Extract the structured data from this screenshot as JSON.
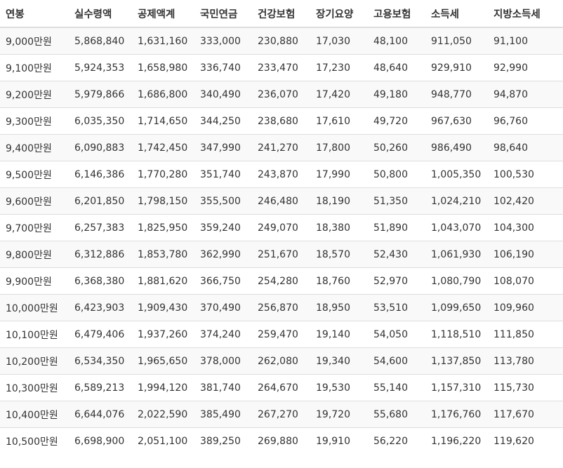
{
  "table": {
    "headers": [
      "연봉",
      "실수령액",
      "공제액계",
      "국민연금",
      "건강보험",
      "장기요양",
      "고용보험",
      "소득세",
      "지방소득세"
    ],
    "rows": [
      [
        "9,000만원",
        "5,868,840",
        "1,631,160",
        "333,000",
        "230,880",
        "17,030",
        "48,100",
        "911,050",
        "91,100"
      ],
      [
        "9,100만원",
        "5,924,353",
        "1,658,980",
        "336,740",
        "233,470",
        "17,230",
        "48,640",
        "929,910",
        "92,990"
      ],
      [
        "9,200만원",
        "5,979,866",
        "1,686,800",
        "340,490",
        "236,070",
        "17,420",
        "49,180",
        "948,770",
        "94,870"
      ],
      [
        "9,300만원",
        "6,035,350",
        "1,714,650",
        "344,250",
        "238,680",
        "17,610",
        "49,720",
        "967,630",
        "96,760"
      ],
      [
        "9,400만원",
        "6,090,883",
        "1,742,450",
        "347,990",
        "241,270",
        "17,800",
        "50,260",
        "986,490",
        "98,640"
      ],
      [
        "9,500만원",
        "6,146,386",
        "1,770,280",
        "351,740",
        "243,870",
        "17,990",
        "50,800",
        "1,005,350",
        "100,530"
      ],
      [
        "9,600만원",
        "6,201,850",
        "1,798,150",
        "355,500",
        "246,480",
        "18,190",
        "51,350",
        "1,024,210",
        "102,420"
      ],
      [
        "9,700만원",
        "6,257,383",
        "1,825,950",
        "359,240",
        "249,070",
        "18,380",
        "51,890",
        "1,043,070",
        "104,300"
      ],
      [
        "9,800만원",
        "6,312,886",
        "1,853,780",
        "362,990",
        "251,670",
        "18,570",
        "52,430",
        "1,061,930",
        "106,190"
      ],
      [
        "9,900만원",
        "6,368,380",
        "1,881,620",
        "366,750",
        "254,280",
        "18,760",
        "52,970",
        "1,080,790",
        "108,070"
      ],
      [
        "10,000만원",
        "6,423,903",
        "1,909,430",
        "370,490",
        "256,870",
        "18,950",
        "53,510",
        "1,099,650",
        "109,960"
      ],
      [
        "10,100만원",
        "6,479,406",
        "1,937,260",
        "374,240",
        "259,470",
        "19,140",
        "54,050",
        "1,118,510",
        "111,850"
      ],
      [
        "10,200만원",
        "6,534,350",
        "1,965,650",
        "378,000",
        "262,080",
        "19,340",
        "54,600",
        "1,137,850",
        "113,780"
      ],
      [
        "10,300만원",
        "6,589,213",
        "1,994,120",
        "381,740",
        "264,670",
        "19,530",
        "55,140",
        "1,157,310",
        "115,730"
      ],
      [
        "10,400만원",
        "6,644,076",
        "2,022,590",
        "385,490",
        "267,270",
        "19,720",
        "55,680",
        "1,176,760",
        "117,670"
      ],
      [
        "10,500만원",
        "6,698,900",
        "2,051,100",
        "389,250",
        "269,880",
        "19,910",
        "56,220",
        "1,196,220",
        "119,620"
      ]
    ]
  }
}
